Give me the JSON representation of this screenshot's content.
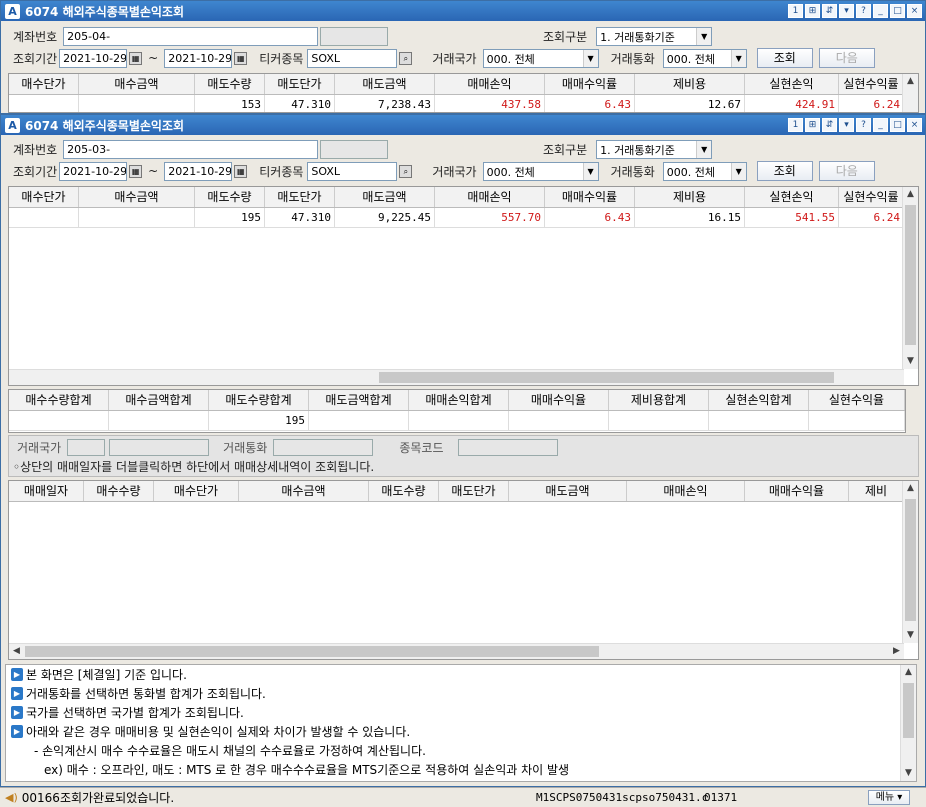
{
  "window": {
    "title": "6074 해외주식종목별손익조회",
    "logo": "A",
    "title_buttons": [
      "1",
      "⊞",
      "⇵",
      "▾",
      "?",
      "_",
      "□",
      "×"
    ]
  },
  "top_window": {
    "account_label": "계좌번호",
    "account_value": "205-04-",
    "query_type_label": "조회구분",
    "query_type_value": "1. 거래통화기준",
    "period_label": "조회기간",
    "date_from": "2021-10-29",
    "date_to": "2021-10-29",
    "tilde": "~",
    "ticker_label": "티커종목",
    "ticker_value": "SOXL",
    "country_label": "거래국가",
    "country_value": "000. 전체",
    "currency_label": "거래통화",
    "currency_value": "000. 전체",
    "search_btn": "조회",
    "next_btn": "다음",
    "headers": [
      "매수단가",
      "매수금액",
      "매도수량",
      "매도단가",
      "매도금액",
      "매매손익",
      "매매수익률",
      "제비용",
      "실현손익",
      "실현수익률"
    ],
    "row": [
      "",
      "",
      "153",
      "47.310",
      "7,238.43",
      "437.58",
      "6.43",
      "12.67",
      "424.91",
      "6.24"
    ]
  },
  "main": {
    "account_label": "계좌번호",
    "account_value": "205-03-",
    "query_type_label": "조회구분",
    "query_type_value": "1. 거래통화기준",
    "period_label": "조회기간",
    "date_from": "2021-10-29",
    "date_to": "2021-10-29",
    "tilde": "~",
    "ticker_label": "티커종목",
    "ticker_value": "SOXL",
    "country_label": "거래국가",
    "country_value": "000. 전체",
    "currency_label": "거래통화",
    "currency_value": "000. 전체",
    "search_btn": "조회",
    "next_btn": "다음",
    "headers": [
      "매수단가",
      "매수금액",
      "매도수량",
      "매도단가",
      "매도금액",
      "매매손익",
      "매매수익률",
      "제비용",
      "실현손익",
      "실현수익률"
    ],
    "row": [
      "",
      "",
      "195",
      "47.310",
      "9,225.45",
      "557.70",
      "6.43",
      "16.15",
      "541.55",
      "6.24"
    ],
    "red_columns": [
      5,
      6,
      8,
      9
    ],
    "summary_headers": [
      "매수수량합계",
      "매수금액합계",
      "매도수량합계",
      "매도금액합계",
      "매매손익합계",
      "매매수익율",
      "제비용합계",
      "실현손익합계",
      "실현수익율"
    ],
    "summary_row": [
      "",
      "",
      "195",
      "",
      "",
      "",
      "",
      "",
      ""
    ],
    "filter": {
      "country_label": "거래국가",
      "currency_label": "거래통화",
      "code_label": "종목코드",
      "hint": "◦상단의 매매일자를 더블클릭하면 하단에서 매매상세내역이 조회됩니다."
    },
    "detail_headers": [
      "매매일자",
      "매수수량",
      "매수단가",
      "매수금액",
      "매도수량",
      "매도단가",
      "매도금액",
      "매매손익",
      "매매수익율",
      "제비"
    ]
  },
  "notes": [
    "본 화면은 [체결일] 기준 입니다.",
    "거래통화를 선택하면 통화별 합계가 조회됩니다.",
    "국가를 선택하면 국가별 합계가 조회됩니다.",
    "아래와 같은 경우 매매비용 및 실현손익이 실제와 차이가 발생할 수 있습니다.",
    "- 손익계산시 매수 수수료율은 매도시 채널의 수수료율로 가정하여 계산됩니다.",
    "ex) 매수 : 오프라인,  매도 : MTS 로 한 경우  매수수수료율을 MTS기준으로 적용하여 실손익과 차이 발생"
  ],
  "status": {
    "message": "00166조회가완료되었습니다.",
    "program": "M1SCPS0750431scpso750431.c",
    "code": "01371",
    "menu": "메뉴"
  },
  "colors": {
    "title_bar": "#2a66b4",
    "red_value": "#d01818"
  }
}
